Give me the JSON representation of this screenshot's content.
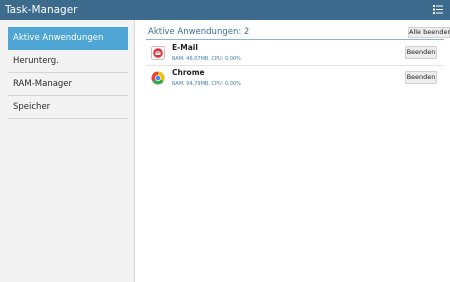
{
  "app": {
    "title": "Task-Manager"
  },
  "sidebar": {
    "items": [
      {
        "label": "Aktive Anwendungen",
        "active": true
      },
      {
        "label": "Herunterg.",
        "active": false
      },
      {
        "label": "RAM-Manager",
        "active": false
      },
      {
        "label": "Speicher",
        "active": false
      }
    ]
  },
  "main": {
    "header_title": "Aktive Anwendungen: 2",
    "end_all_label": "Alle beenden",
    "apps": [
      {
        "name": "E-Mail",
        "stats": "RAM: 46,07MB, CPU: 0,00%",
        "end_label": "Beenden",
        "icon": "email-icon"
      },
      {
        "name": "Chrome",
        "stats": "RAM: 94,79MB, CPU: 0,00%",
        "end_label": "Beenden",
        "icon": "chrome-icon"
      }
    ]
  },
  "colors": {
    "titlebar": "#3d6b8e",
    "accent": "#4fa6d4",
    "header_text": "#3a6f96",
    "stats_text": "#3f7fb0"
  }
}
